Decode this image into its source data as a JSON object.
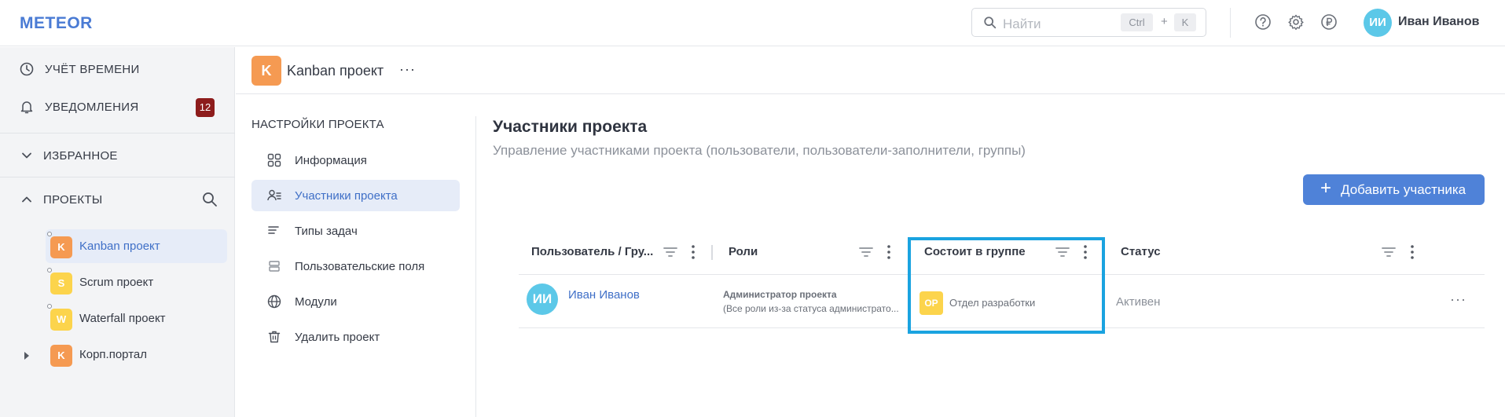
{
  "app": {
    "logo": "METEOR"
  },
  "search": {
    "placeholder": "Найти",
    "kbd_ctrl": "Ctrl",
    "kbd_plus": "+",
    "kbd_key": "K"
  },
  "user": {
    "initials": "ИИ",
    "name": "Иван Иванов"
  },
  "sidebar": {
    "time": "УЧЁТ ВРЕМЕНИ",
    "notifications": "УВЕДОМЛЕНИЯ",
    "notifications_count": "12",
    "favorites": "ИЗБРАННОЕ",
    "projects_header": "ПРОЕКТЫ",
    "projects": [
      {
        "letter": "K",
        "name": "Kanban проект",
        "color": "#f59a52"
      },
      {
        "letter": "S",
        "name": "Scrum проект",
        "color": "#fcd44c"
      },
      {
        "letter": "W",
        "name": "Waterfall проект",
        "color": "#fcd44c"
      },
      {
        "letter": "K",
        "name": "Корп.портал",
        "color": "#f59a52"
      }
    ]
  },
  "project": {
    "letter": "K",
    "title": "Kanban проект",
    "more": "···"
  },
  "settings": {
    "title": "НАСТРОЙКИ ПРОЕКТА",
    "items": [
      {
        "label": "Информация",
        "icon": "grid-icon"
      },
      {
        "label": "Участники проекта",
        "icon": "users-icon"
      },
      {
        "label": "Типы задач",
        "icon": "list-icon"
      },
      {
        "label": "Пользовательские поля",
        "icon": "fields-icon"
      },
      {
        "label": "Модули",
        "icon": "globe-icon"
      },
      {
        "label": "Удалить проект",
        "icon": "trash-icon"
      }
    ]
  },
  "main": {
    "title": "Участники проекта",
    "subtitle": "Управление участниками проекта (пользователи, пользователи-заполнители, группы)",
    "add_button": "Добавить участника",
    "columns": [
      "Пользователь / Гру...",
      "Роли",
      "Состоит в группе",
      "Статус"
    ],
    "rows": [
      {
        "initials": "ИИ",
        "name": "Иван Иванов",
        "role": "Администратор проекта",
        "role_desc": "(Все роли из-за статуса администрато...",
        "group_initials": "ОР",
        "group": "Отдел разработки",
        "status": "Активен",
        "more": "···"
      }
    ]
  },
  "colors": {
    "accent": "#4f82d8",
    "highlight": "#1aa3e0",
    "badge": "#8d1c1c"
  }
}
